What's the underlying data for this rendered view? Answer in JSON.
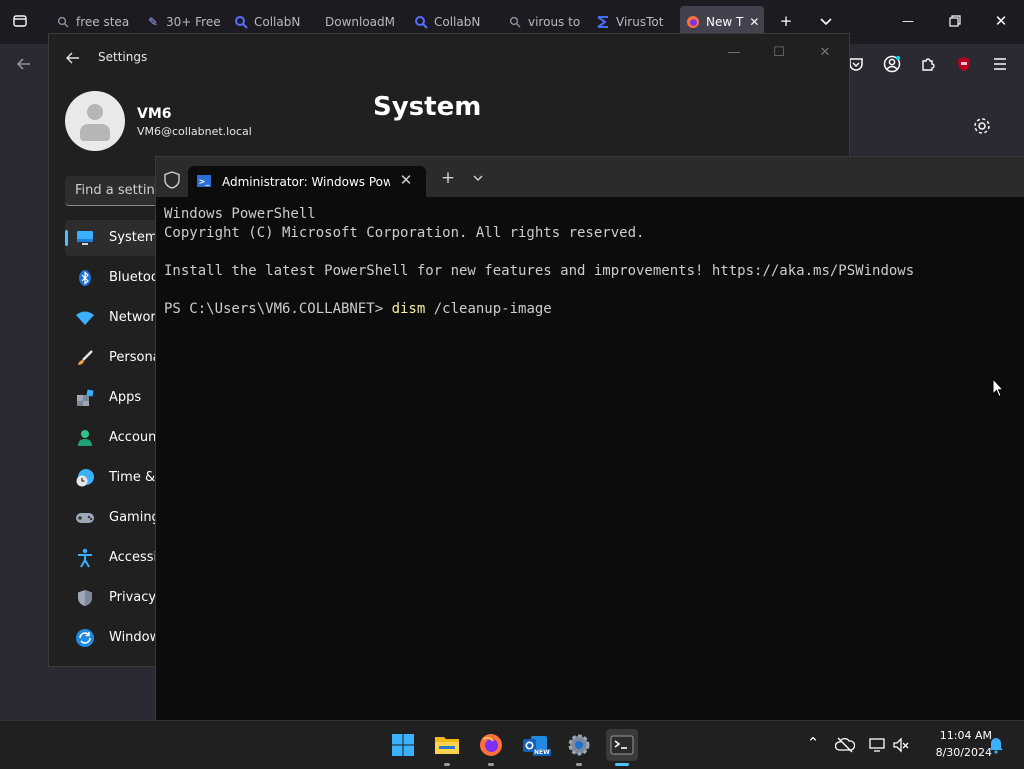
{
  "firefox": {
    "tabs": [
      {
        "label": "free stea",
        "icon": "search-icon"
      },
      {
        "label": "30+ Free",
        "icon": "pen-icon"
      },
      {
        "label": "CollabN",
        "icon": "search-icon"
      },
      {
        "label": "DownloadM",
        "icon": ""
      },
      {
        "label": "CollabN",
        "icon": "search-icon"
      },
      {
        "label": "virous to",
        "icon": "search-icon"
      },
      {
        "label": "VirusTot",
        "icon": "virustotal-icon"
      },
      {
        "label": "New T",
        "icon": "firefox-icon"
      }
    ],
    "controls": {
      "new_tab": "+",
      "list_tabs": "⌄",
      "minimize": "—",
      "restore": "❐",
      "close": "✕"
    }
  },
  "settings": {
    "app_title": "Settings",
    "user_name": "VM6",
    "user_email": "VM6@collabnet.local",
    "page_title": "System",
    "search_placeholder": "Find a setting",
    "nav": [
      {
        "label": "System",
        "icon": "monitor-icon"
      },
      {
        "label": "Bluetooth & devices",
        "icon": "bluetooth-icon"
      },
      {
        "label": "Network & internet",
        "icon": "wifi-icon"
      },
      {
        "label": "Personalization",
        "icon": "brush-icon"
      },
      {
        "label": "Apps",
        "icon": "apps-icon"
      },
      {
        "label": "Accounts",
        "icon": "person-icon"
      },
      {
        "label": "Time & language",
        "icon": "clock-globe-icon"
      },
      {
        "label": "Gaming",
        "icon": "gamepad-icon"
      },
      {
        "label": "Accessibility",
        "icon": "accessibility-icon"
      },
      {
        "label": "Privacy & security",
        "icon": "shield-icon"
      },
      {
        "label": "Windows Update",
        "icon": "update-icon"
      }
    ]
  },
  "terminal": {
    "tab_title": "Administrator: Windows PowerShell",
    "new_tab": "+",
    "lines": {
      "l1": "Windows PowerShell",
      "l2": "Copyright (C) Microsoft Corporation. All rights reserved.",
      "l3": "Install the latest PowerShell for new features and improvements! https://aka.ms/PSWindows",
      "prompt": "PS C:\\Users\\VM6.COLLABNET> ",
      "command": "dism",
      "args": " /cleanup-image"
    }
  },
  "taskbar": {
    "time": "11:04 AM",
    "date": "8/30/2024",
    "outlook_badge": "NEW",
    "tray_chevron": "⌃",
    "colors": {
      "accent": "#4cc2ff",
      "taskbar": "#202020"
    }
  }
}
